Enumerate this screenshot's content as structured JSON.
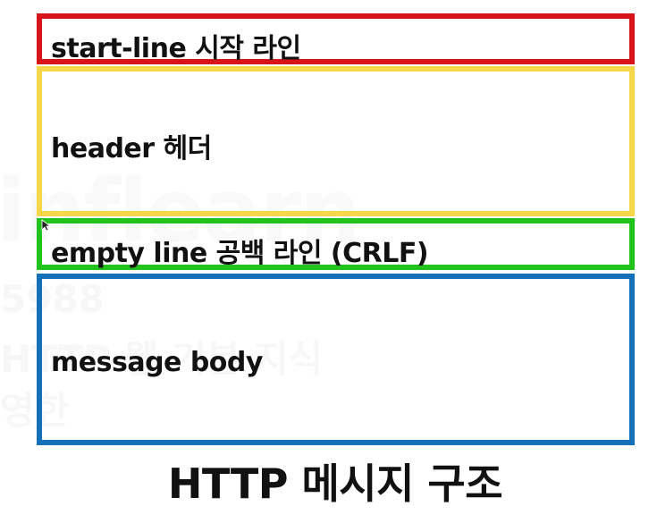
{
  "diagram": {
    "sections": [
      {
        "label": "start-line 시작 라인",
        "color": "#d7141a"
      },
      {
        "label": "header 헤더",
        "color": "#f6d64b"
      },
      {
        "label": "empty line 공백 라인 (CRLF)",
        "color": "#22c21c"
      },
      {
        "label": "message body",
        "color": "#1570b8"
      }
    ],
    "caption": "HTTP 메시지 구조"
  },
  "watermark": {
    "logo": "inflearn",
    "lines": [
      "5988",
      "HTTP 웹 기본 지식",
      "영한"
    ]
  }
}
